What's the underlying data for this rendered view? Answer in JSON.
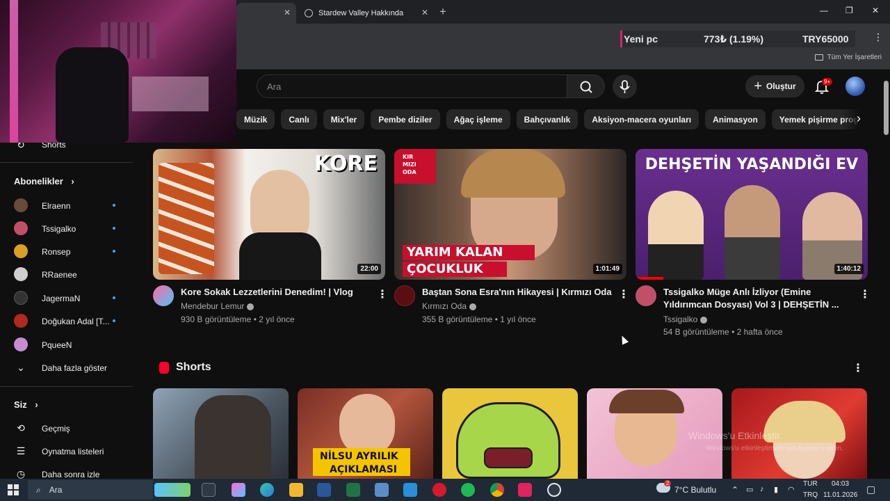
{
  "browser": {
    "tabs": [
      {
        "label": "",
        "active": true
      },
      {
        "label": "Stardew Valley Hakkında",
        "active": false
      }
    ],
    "ticker": {
      "name": "Yeni pc",
      "change": "773₺ (1.19%)",
      "target": "TRY65000"
    },
    "bookmarks_label": "Tüm Yer İşaretleri"
  },
  "header": {
    "search_placeholder": "Ara",
    "create_label": "Oluştur",
    "notifications_badge": "9+"
  },
  "chips": [
    "Müzik",
    "Canlı",
    "Mix'ler",
    "Pembe diziler",
    "Ağaç işleme",
    "Bahçıvanlık",
    "Aksiyon-macera oyunları",
    "Animasyon",
    "Yemek pişirme programları"
  ],
  "sidebar": {
    "shorts_label": "Shorts",
    "subscriptions_header": "Abonelikler",
    "subscriptions": [
      {
        "label": "Elraenn",
        "color": "#6b4a3a"
      },
      {
        "label": "Tssigalko",
        "color": "#c0506a"
      },
      {
        "label": "Ronsep",
        "color": "#d9a024"
      },
      {
        "label": "RRaenee",
        "color": "#cfcfcf"
      },
      {
        "label": "JagermaN",
        "color": "#333333"
      },
      {
        "label": "Doğukan Adal [T...",
        "color": "#b22a1e"
      },
      {
        "label": "PqueeN",
        "color": "#c78bd4"
      }
    ],
    "show_more": "Daha fazla göster",
    "you_header": "Siz",
    "you_items": [
      {
        "label": "Geçmiş",
        "icon": "history-icon"
      },
      {
        "label": "Oynatma listeleri",
        "icon": "playlists-icon"
      },
      {
        "label": "Daha sonra izle",
        "icon": "watch-later-icon"
      }
    ]
  },
  "videos": [
    {
      "title": "Kore Sokak Lezzetlerini Denedim! | Vlog",
      "channel": "Mendebur Lemur",
      "meta": "930 B görüntüleme • 2 yıl önce",
      "duration": "22:00",
      "thumb_text": "KORE"
    },
    {
      "title": "Baştan Sona Esra'nın Hikayesi | Kırmızı Oda",
      "channel": "Kırmızı Oda",
      "meta": "355 B görüntüleme • 1 yıl önce",
      "duration": "1:01:49",
      "thumb_logo_1": "KIR",
      "thumb_logo_2": "MIZI",
      "thumb_logo_3": "ODA",
      "thumb_text_1": "YARIM KALAN",
      "thumb_text_2": "ÇOCUKLUK"
    },
    {
      "title_line1": "Tssigalko Müge Anlı İzliyor (Emine",
      "title_line2": "Yıldırımcan Dosyası) Vol 3 | DEHŞETİN ...",
      "channel": "Tssigalko",
      "meta": "54 B görüntüleme • 2 hafta önce",
      "duration": "1:40:12",
      "thumb_text": "DEHŞETİN YAŞANDIĞI EV"
    }
  ],
  "shorts": {
    "section_title": "Shorts",
    "items": [
      {
        "thumb_text": ""
      },
      {
        "thumb_text_1": "NİLSU AYRILIK",
        "thumb_text_2": "AÇIKLAMASI"
      },
      {
        "thumb_text": ""
      },
      {
        "thumb_text": ""
      },
      {
        "thumb_text": ""
      }
    ]
  },
  "watermark": {
    "line1": "Windows'u Etkinleştir",
    "line2": "Windows'u etkinleştirmek için Ayarlar'a gidin."
  },
  "taskbar": {
    "search_label": "Ara",
    "weather": "7°C  Bulutlu",
    "weather_badge": "2",
    "lang_line1": "TUR",
    "lang_line2": "TRQ",
    "time": "04:03",
    "date": "11.01.2026"
  }
}
